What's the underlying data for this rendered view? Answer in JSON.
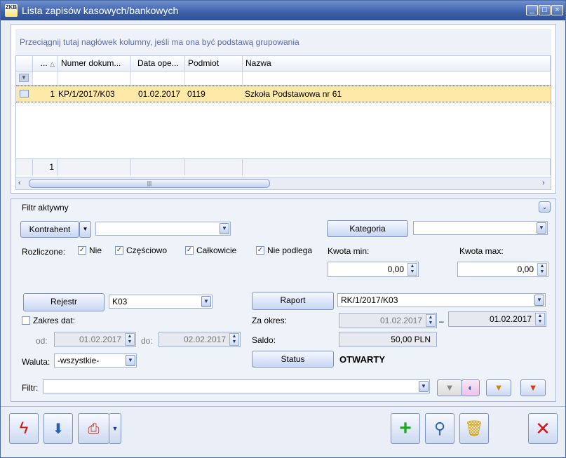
{
  "window": {
    "title": "Lista zapisów kasowych/bankowych",
    "app_icon_text": "ZKB"
  },
  "grid": {
    "group_hint": "Przeciągnij tutaj nagłówek kolumny, jeśli ma ona być podstawą grupowania",
    "columns": [
      "...",
      "Numer dokum...",
      "Data ope...",
      "Podmiot",
      "Nazwa"
    ],
    "rows": [
      {
        "lp": "1",
        "numer": "KP/1/2017/K03",
        "data": "01.02.2017",
        "podmiot": "0119",
        "nazwa": "Szkoła Podstawowa nr 61"
      }
    ],
    "footer_count": "1"
  },
  "filter": {
    "header": "Filtr aktywny",
    "kontrahent_label": "Kontrahent",
    "kontrahent_value": "",
    "kategoria_label": "Kategoria",
    "kategoria_value": "",
    "rozliczone_label": "Rozliczone:",
    "checks": [
      "Nie",
      "Częściowo",
      "Całkowicie",
      "Nie podlega"
    ],
    "kwota_min_label": "Kwota min:",
    "kwota_min_value": "0,00",
    "kwota_max_label": "Kwota max:",
    "kwota_max_value": "0,00",
    "rejestr_label": "Rejestr",
    "rejestr_value": "K03",
    "raport_label": "Raport",
    "raport_value": "RK/1/2017/K03",
    "zakres_label": "Zakres dat:",
    "od_label": "od:",
    "od_value": "01.02.2017",
    "do_label": "do:",
    "do_value": "02.02.2017",
    "za_okres_label": "Za okres:",
    "za_okres_from": "01.02.2017",
    "za_okres_dash": "–",
    "za_okres_to": "01.02.2017",
    "saldo_label": "Saldo:",
    "saldo_value": "50,00 PLN",
    "status_label": "Status",
    "status_value": "OTWARTY",
    "waluta_label": "Waluta:",
    "waluta_value": "-wszystkie-",
    "filtr_label": "Filtr:",
    "filtr_value": ""
  },
  "colors": {
    "selected_row": "#ffe9a8",
    "accent": "#3c5fa8"
  }
}
